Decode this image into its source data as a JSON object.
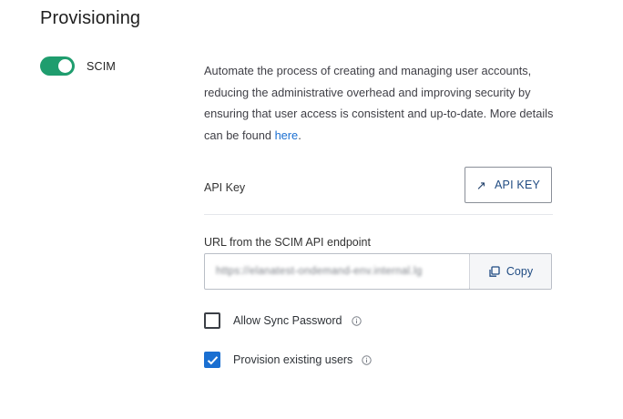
{
  "section": {
    "title": "Provisioning"
  },
  "scim": {
    "label": "SCIM",
    "enabled": true
  },
  "description": {
    "text": "Automate the process of creating and managing user accounts, reducing the administrative overhead and improving security by ensuring that user access is consistent and up-to-date. More details can be found ",
    "link_text": "here",
    "suffix": "."
  },
  "api_key": {
    "label": "API Key",
    "button_label": "API KEY",
    "button_icon": "external-arrow-icon"
  },
  "endpoint": {
    "label": "URL from the SCIM API endpoint",
    "value": "https://elanatest-ondemand-env.internal.lg",
    "copy_label": "Copy",
    "copy_icon": "copy-icon"
  },
  "options": [
    {
      "label": "Allow Sync Password",
      "checked": false,
      "icon": "info-icon"
    },
    {
      "label": "Provision existing users",
      "checked": true,
      "icon": "info-icon"
    }
  ],
  "colors": {
    "toggle_on": "#1f9d6e",
    "accent": "#1a6fd1",
    "button_text": "#1f4b82"
  }
}
